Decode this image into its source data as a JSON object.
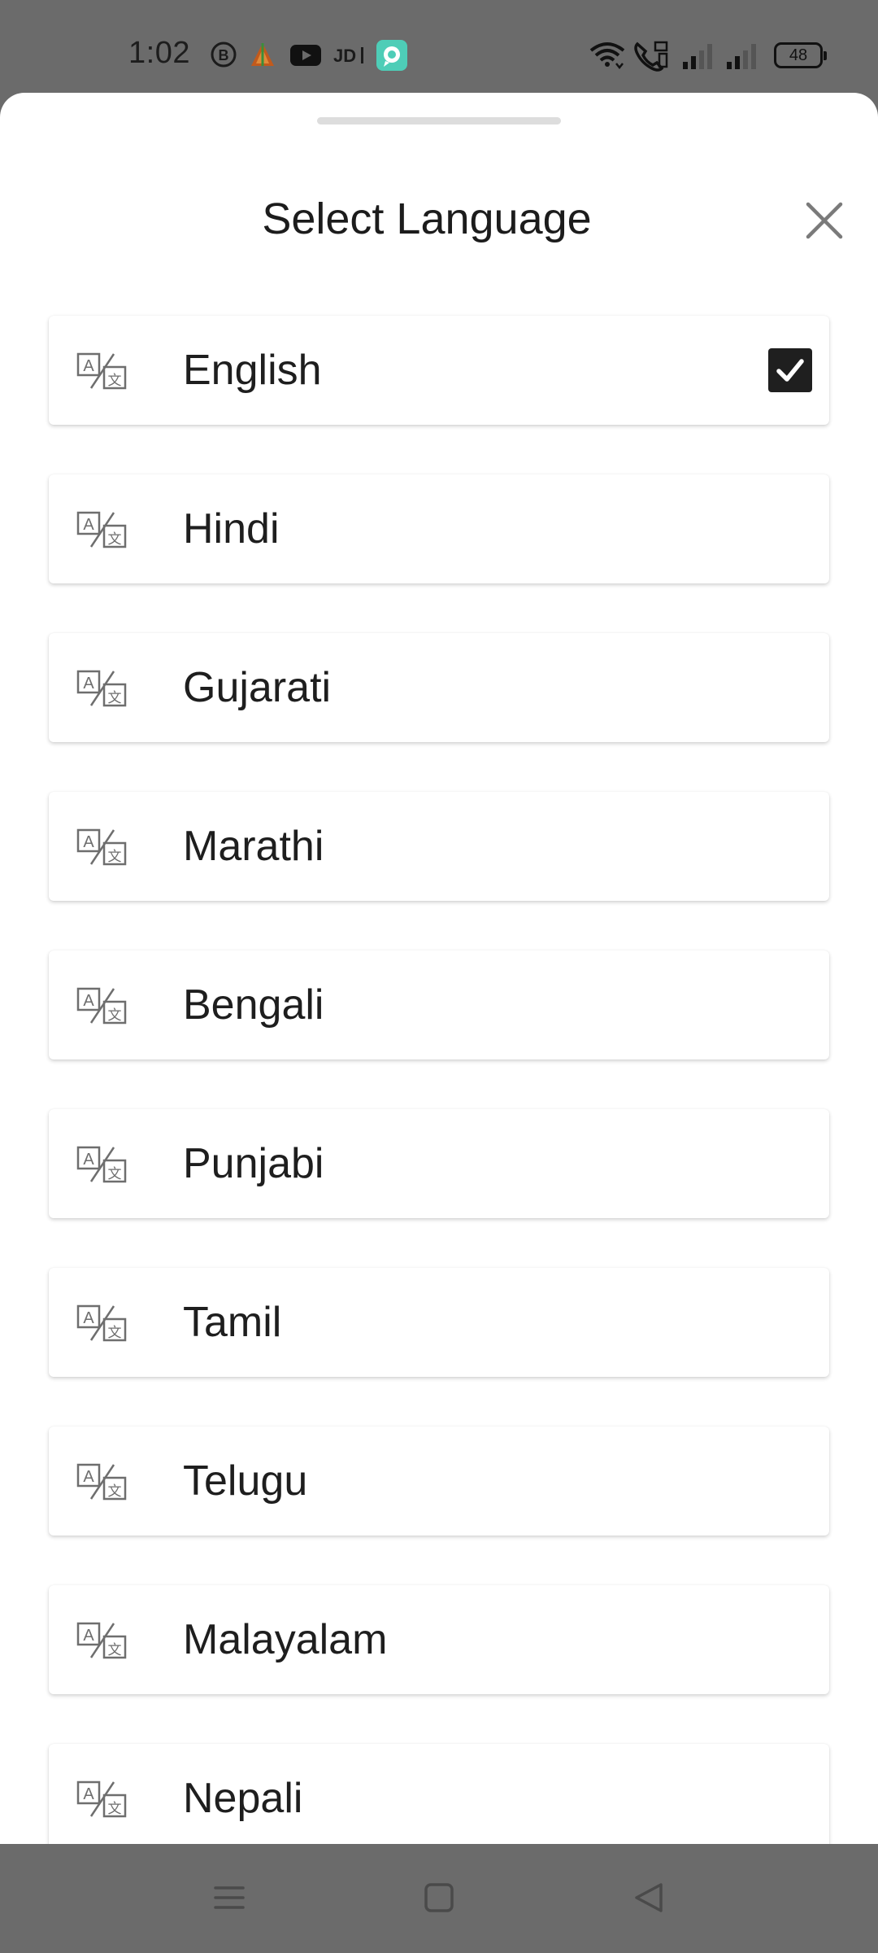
{
  "status_bar": {
    "time": "1:02",
    "battery_level": "48",
    "left_icons": [
      "b-app-icon",
      "pyramid-app-icon",
      "youtube-icon",
      "jd-app-icon",
      "chat-app-icon"
    ],
    "right_icons": [
      "wifi-icon",
      "volte-call-icon",
      "signal-sim1-icon",
      "signal-sim2-icon",
      "battery-icon"
    ]
  },
  "sheet": {
    "title": "Select Language",
    "close_icon": "close-icon"
  },
  "languages": [
    {
      "label": "English",
      "selected": true
    },
    {
      "label": "Hindi",
      "selected": false
    },
    {
      "label": "Gujarati",
      "selected": false
    },
    {
      "label": "Marathi",
      "selected": false
    },
    {
      "label": "Bengali",
      "selected": false
    },
    {
      "label": "Punjabi",
      "selected": false
    },
    {
      "label": "Tamil",
      "selected": false
    },
    {
      "label": "Telugu",
      "selected": false
    },
    {
      "label": "Malayalam",
      "selected": false
    },
    {
      "label": "Nepali",
      "selected": false
    }
  ],
  "nav_bar": {
    "buttons": [
      "menu-icon",
      "home-icon",
      "back-icon"
    ]
  },
  "colors": {
    "scrim": "#6b6b6b",
    "sheet_background": "#ffffff",
    "text": "#1e1e1e",
    "checkbox": "#1f1f1f"
  }
}
